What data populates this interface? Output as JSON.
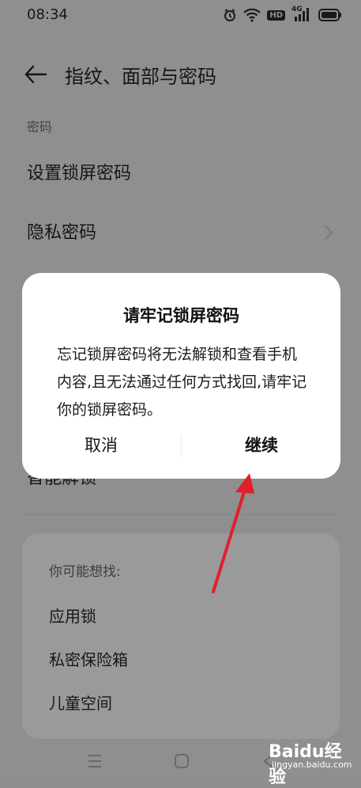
{
  "status_bar": {
    "time": "08:34",
    "hd_badge": "HD",
    "network": "4G"
  },
  "header": {
    "title": "指纹、面部与密码"
  },
  "section": {
    "title": "密码"
  },
  "rows": [
    {
      "label": "设置锁屏密码"
    },
    {
      "label": "隐私密码"
    }
  ],
  "partial_row": "智能解锁",
  "suggestions": {
    "title": "你可能想找:",
    "items": [
      "应用锁",
      "私密保险箱",
      "儿童空间"
    ]
  },
  "dialog": {
    "title": "请牢记锁屏密码",
    "message": "忘记锁屏密码将无法解锁和查看手机内容,且无法通过任何方式找回,请牢记你的锁屏密码。",
    "cancel_label": "取消",
    "continue_label": "继续"
  },
  "watermark": {
    "logo": "Baidu经验",
    "sub": "jingyan.baidu.com"
  },
  "colors": {
    "annotation_arrow": "#e0202a"
  }
}
